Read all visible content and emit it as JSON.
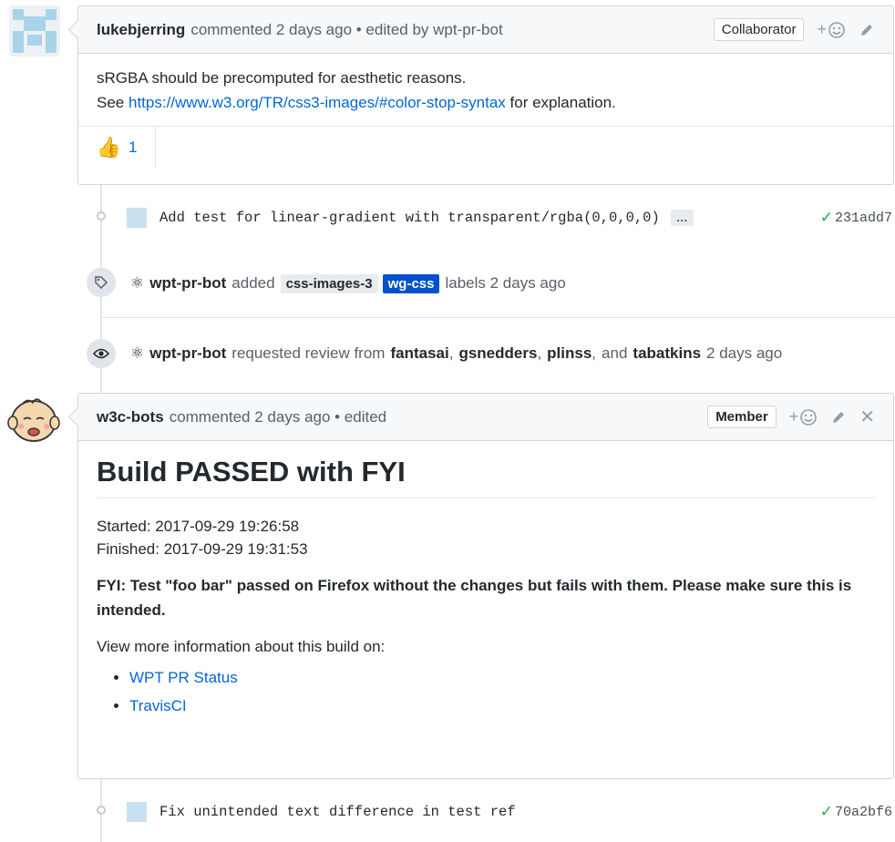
{
  "comment1": {
    "author": "lukebjerring",
    "meta": "commented 2 days ago • edited by wpt-pr-bot",
    "badge": "Collaborator",
    "body_line1": "sRGBA should be precomputed for aesthetic reasons.",
    "body_see": "See",
    "body_link": "https://www.w3.org/TR/css3-images/#color-stop-syntax",
    "body_after": "for explanation.",
    "reaction_emoji": "👍",
    "reaction_count": "1"
  },
  "commit1": {
    "message": "Add test for linear-gradient with transparent/rgba(0,0,0,0)",
    "ellipsis": "…",
    "sha": "231add7"
  },
  "labels_event": {
    "actor": "wpt-pr-bot",
    "verb": "added",
    "label1": "css-images-3",
    "label1_color": "#e9ebee",
    "label2": "wg-css",
    "label2_color": "#0052cc",
    "suffix": "labels 2 days ago"
  },
  "review_event": {
    "actor": "wpt-pr-bot",
    "verb": "requested review from",
    "r1": "fantasai",
    "r2": "gsnedders",
    "r3": "plinss",
    "and": "and",
    "r4": "tabatkins",
    "time": "2 days ago"
  },
  "comment2": {
    "author": "w3c-bots",
    "meta": "commented 2 days ago • edited",
    "badge": "Member",
    "heading": "Build PASSED with FYI",
    "started": "Started: 2017-09-29 19:26:58",
    "finished": "Finished: 2017-09-29 19:31:53",
    "fyi": "FYI: Test \"foo bar\" passed on Firefox without the changes but fails with them. Please make sure this is intended.",
    "view_more": "View more information about this build on:",
    "links": [
      "WPT PR Status",
      "TravisCI"
    ]
  },
  "commit2": {
    "message": "Fix unintended text difference in test ref",
    "sha": "70a2bf6"
  },
  "colors": {
    "link": "#0366d6",
    "success": "#28a745"
  }
}
